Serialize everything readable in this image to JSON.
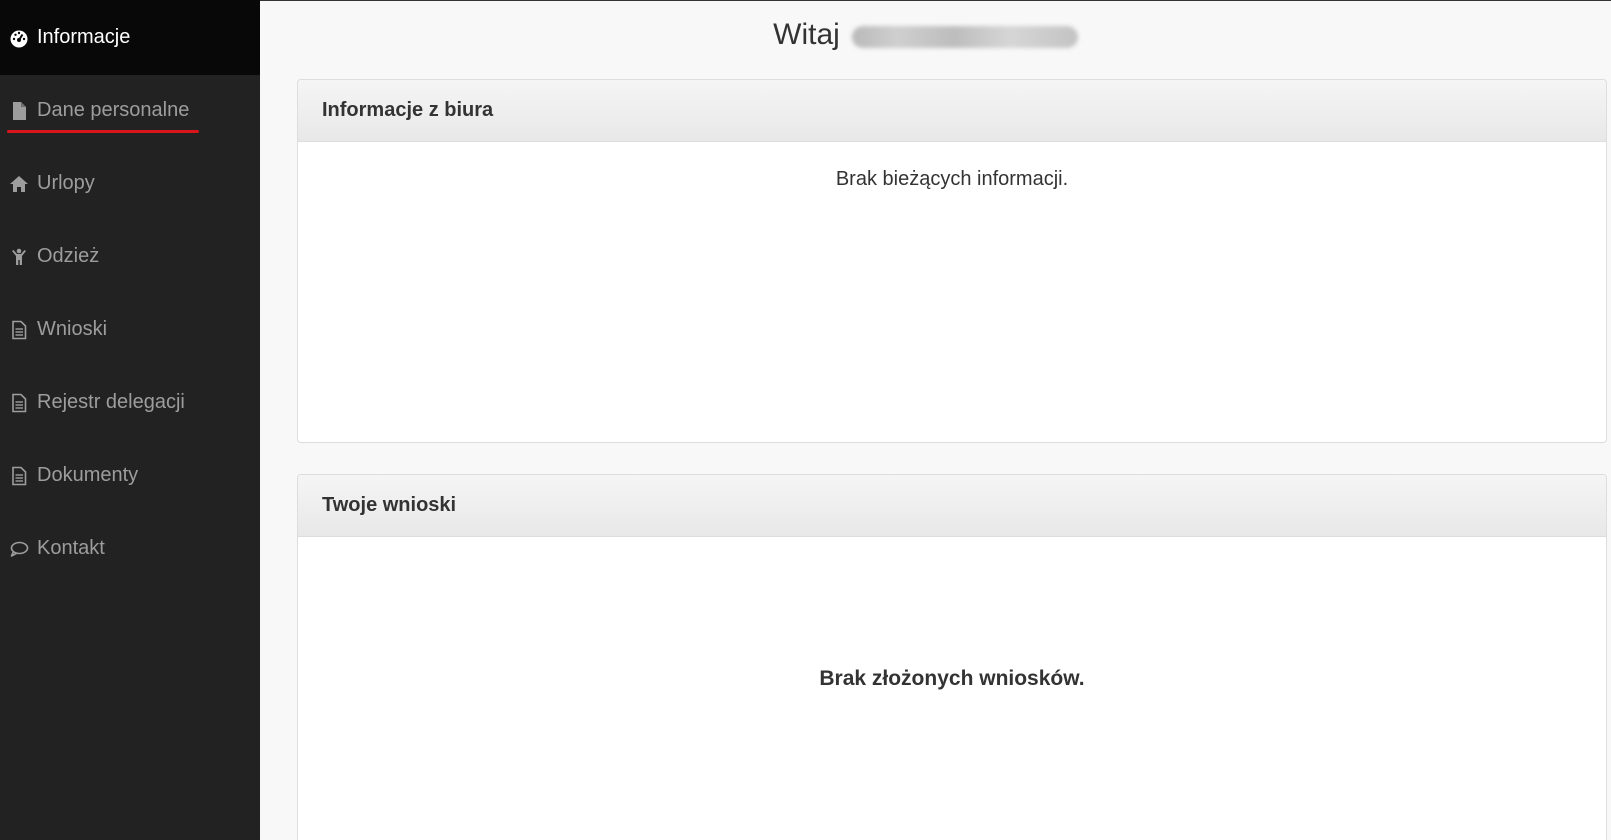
{
  "sidebar": {
    "items": [
      {
        "label": "Informacje",
        "icon": "dashboard-icon"
      },
      {
        "label": "Dane personalne",
        "icon": "file-icon"
      },
      {
        "label": "Urlopy",
        "icon": "home-icon"
      },
      {
        "label": "Odzież",
        "icon": "child-icon"
      },
      {
        "label": "Wnioski",
        "icon": "file-text-icon"
      },
      {
        "label": "Rejestr delegacji",
        "icon": "file-text-icon"
      },
      {
        "label": "Dokumenty",
        "icon": "file-text-icon"
      },
      {
        "label": "Kontakt",
        "icon": "comment-icon"
      }
    ],
    "active_index": 0,
    "underline_color": "#d9141b"
  },
  "header": {
    "greeting": "Witaj"
  },
  "panels": {
    "office_info": {
      "title": "Informacje z biura",
      "body": "Brak bieżących informacji."
    },
    "requests": {
      "title": "Twoje wnioski",
      "body": "Brak złożonych wniosków."
    }
  },
  "colors": {
    "sidebar_bg": "#222222",
    "active_bg": "#080808",
    "accent": "#d9141b"
  }
}
